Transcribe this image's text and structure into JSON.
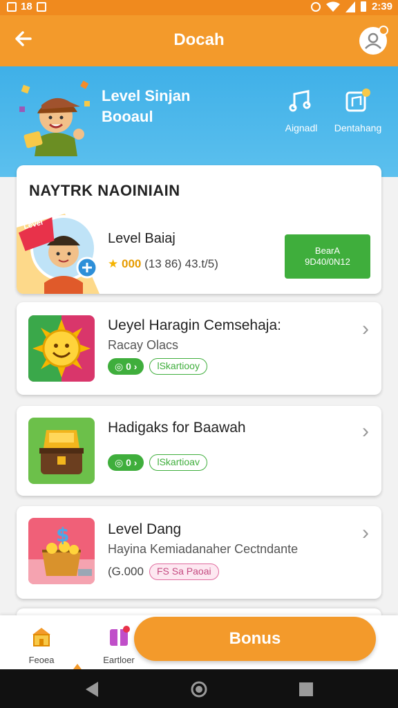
{
  "status_bar": {
    "left_text": "18",
    "time": "2:39"
  },
  "app_bar": {
    "title": "Docah"
  },
  "banner": {
    "title_line1": "Level Sinjan",
    "title_line2": "Booaul",
    "actions": [
      {
        "label": "Aignadl",
        "icon": "music-note-icon"
      },
      {
        "label": "Dentahang",
        "icon": "music-notes-badge-icon"
      }
    ]
  },
  "section": {
    "title": "NAYTRK NAOINIAIN",
    "level_badge": "Level",
    "level_name": "Level Baiaj",
    "points": "000",
    "stats": "(13 86) 43.t/5)",
    "button_line1": "BearA",
    "button_line2": "9D40/0N12"
  },
  "rewards": [
    {
      "title": "Ueyel Haragin Cemsehaja:",
      "subtitle": "Racay Olacs",
      "pill_value": "0",
      "pill_tag": "lSkartiooy",
      "icon": "sun-face-icon"
    },
    {
      "title": "Hadigaks for Baawah",
      "subtitle": "",
      "pill_value": "0",
      "pill_tag": "lSkartioav",
      "icon": "treasure-chest-icon"
    },
    {
      "title": "Level Dang",
      "subtitle": "Hayina Kemiadanaher Cectndante",
      "pill_value": "(G.000",
      "pill_tag": "FS Sa Paoai",
      "icon": "money-basket-icon"
    }
  ],
  "bottom_nav": {
    "items": [
      {
        "label": "Feoea",
        "icon": "shop-icon"
      },
      {
        "label": "Eartloer",
        "icon": "gift-box-icon"
      }
    ],
    "bonus_label": "Bonus"
  },
  "colors": {
    "primary_orange": "#f39a2b",
    "banner_blue": "#4ab6eb",
    "accent_green": "#3fae3c"
  }
}
